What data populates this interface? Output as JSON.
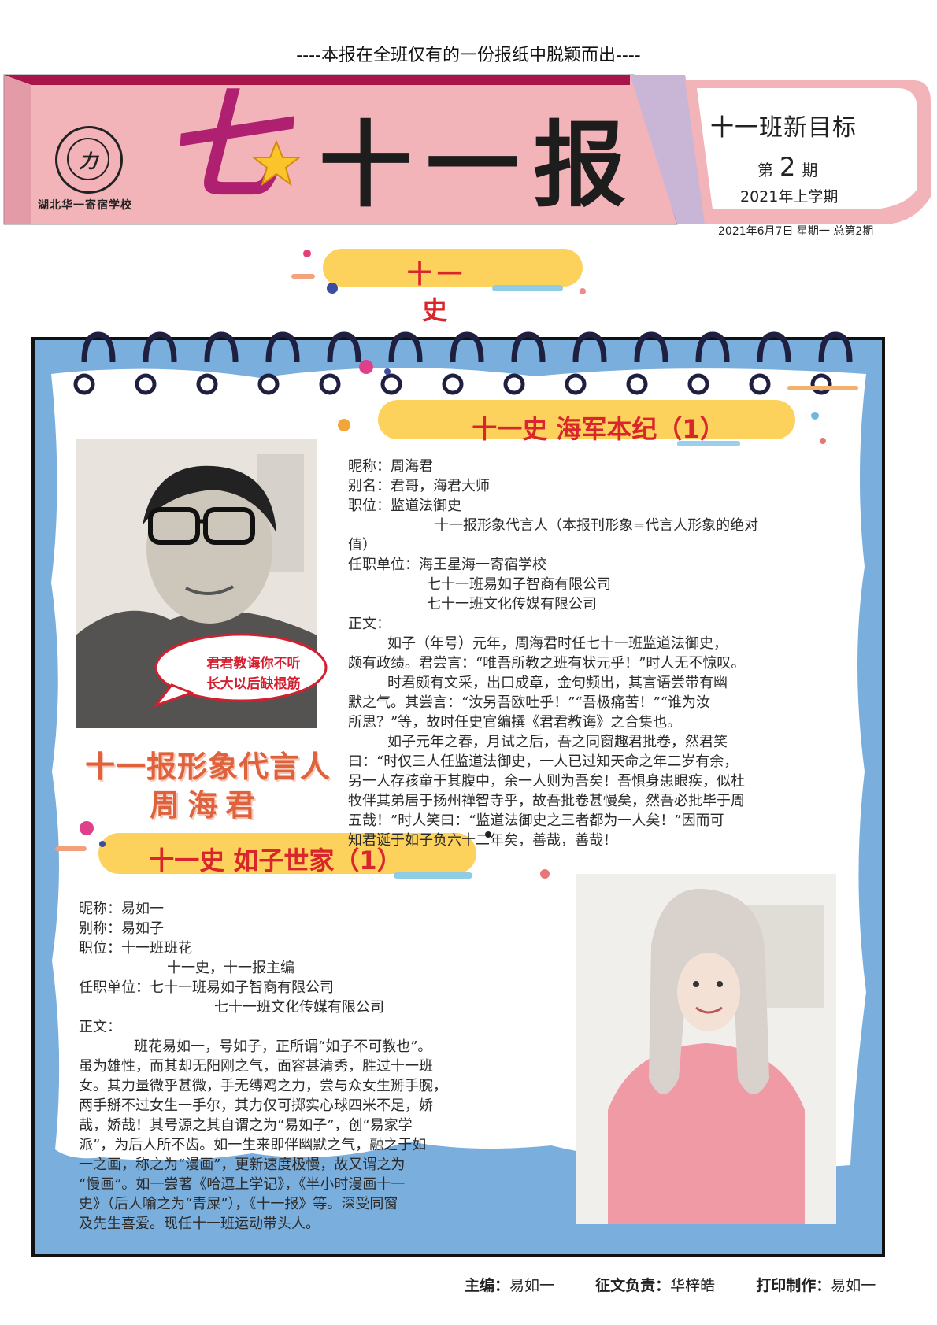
{
  "header": {
    "tagline": "----本报在全班仅有的一份报纸中脱颖而出----",
    "school_logo_mark": "力",
    "school_name": "湖北华一寄宿学校",
    "big_seven": "七",
    "paper_title": "十一报",
    "target": "十一班新目标",
    "issue_prefix": "第",
    "issue_number": "2",
    "issue_suffix": "期",
    "term": "2021年上学期",
    "date_line": "2021年6月7日 星期一 总第2期"
  },
  "section": {
    "title": "十一史"
  },
  "article1": {
    "title": "十一史  海军本纪（1）",
    "lines": [
      "昵称：周海君",
      "别名：君哥，海君大师",
      "职位：监道法御史",
      "十一报形象代言人（本报刊形象=代言人形象的绝对",
      "值）",
      "任职单位：海王星海一寄宿学校",
      "七十一班易如子智商有限公司",
      "七十一班文化传媒有限公司",
      "正文：",
      "如子（年号）元年，周海君时任七十一班监道法御史，",
      "颇有政绩。君尝言：“唯吾所教之班有状元乎！”时人无不惊叹。",
      "时君颇有文采，出口成章，金句频出，其言语尝带有幽",
      "默之气。其尝言：“汝另吾欧吐乎！”“吾极痛苦！”“谁为汝",
      "所思？”等，故时任史官编撰《君君教诲》之合集也。",
      "如子元年之春，月试之后，吾之同窗趣君批卷，然君笑",
      "曰：“时仅三人任监道法御史，一人已过知天命之年二岁有余，",
      "另一人存孩童于其腹中，余一人则为吾矣！吾惧身患眼疾，似杜",
      "牧伴其弟居于扬州禅智寺乎，故吾批卷甚慢矣，然吾必批毕于周",
      "五哉！”时人笑曰：“监道法御史之三者都为一人矣！”因而可",
      "知君诞于如子负六十二年矣，善哉，善哉！"
    ]
  },
  "photo1": {
    "bubble_line1": "君君教诲你不听",
    "bubble_line2": "长大以后缺根筋",
    "spokes_title": "十一报形象代言人",
    "spokes_name": "周海君"
  },
  "article2": {
    "title": "十一史  如子世家（1）",
    "lines": [
      "昵称：易如一",
      "别称：易如子",
      "职位：十一班班花",
      "十一史，十一报主编",
      "任职单位：七十一班易如子智商有限公司",
      "七十一班文化传媒有限公司",
      "正文：",
      "班花易如一，号如子，正所谓“如子不可教也”。",
      "虽为雄性，而其却无阳刚之气，面容甚清秀，胜过十一班",
      "女。其力量微乎甚微，手无缚鸡之力，尝与众女生掰手腕，",
      "两手掰不过女生一手尔，其力仅可掷实心球四米不足，娇",
      "哉，娇哉！其号源之其自谓之为“易如子”，创“易家学",
      "派”，为后人所不齿。如一生来即伴幽默之气，融之于如",
      "一之画，称之为“漫画”，更新速度极慢，故又谓之为",
      "“慢画”。如一尝著《哈逗上学记》，《半小时漫画十一",
      "史》（后人喻之为“青屎”），《十一报》等。深受同窗",
      "及先生喜爱。现任十一班运动带头人。"
    ]
  },
  "footer": {
    "editor_label": "主编：",
    "editor": "易如一",
    "solicit_label": "征文负责：",
    "solicit": "华梓皓",
    "print_label": "打印制作：",
    "print": "易如一"
  },
  "colors": {
    "banner_pink": "#f2b4b8",
    "banner_maroon": "#a8154b",
    "frame_blue": "#7aaedd",
    "pill_yellow": "#fdd25c",
    "title_red": "#d9262d"
  }
}
